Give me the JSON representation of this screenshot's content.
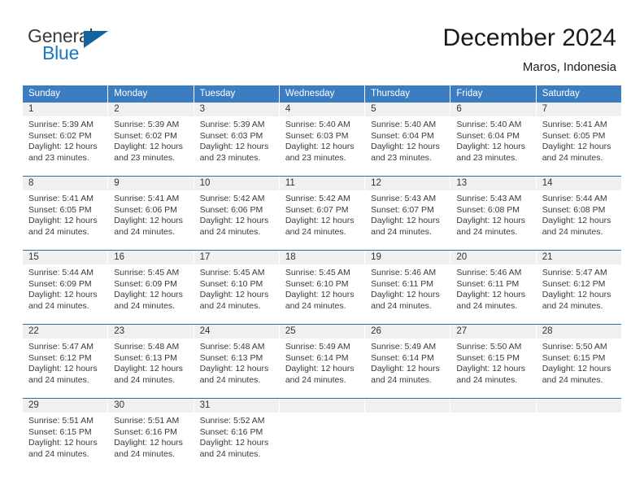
{
  "brand": {
    "name_part1": "General",
    "name_part2": "Blue",
    "logo_icon": "blue-triangle-icon"
  },
  "header": {
    "month_title": "December 2024",
    "location": "Maros, Indonesia"
  },
  "calendar": {
    "weekday_headers": [
      "Sunday",
      "Monday",
      "Tuesday",
      "Wednesday",
      "Thursday",
      "Friday",
      "Saturday"
    ],
    "colors": {
      "header_blue": "#3b7dc0",
      "row_divider_blue": "#2f6fad",
      "daynum_band": "#f0f0f0",
      "brand_blue": "#1779c4",
      "brand_gray": "#3b3b3b"
    },
    "weeks": [
      [
        {
          "day": "1",
          "sunrise": "Sunrise: 5:39 AM",
          "sunset": "Sunset: 6:02 PM",
          "daylight_line1": "Daylight: 12 hours",
          "daylight_line2": "and 23 minutes."
        },
        {
          "day": "2",
          "sunrise": "Sunrise: 5:39 AM",
          "sunset": "Sunset: 6:02 PM",
          "daylight_line1": "Daylight: 12 hours",
          "daylight_line2": "and 23 minutes."
        },
        {
          "day": "3",
          "sunrise": "Sunrise: 5:39 AM",
          "sunset": "Sunset: 6:03 PM",
          "daylight_line1": "Daylight: 12 hours",
          "daylight_line2": "and 23 minutes."
        },
        {
          "day": "4",
          "sunrise": "Sunrise: 5:40 AM",
          "sunset": "Sunset: 6:03 PM",
          "daylight_line1": "Daylight: 12 hours",
          "daylight_line2": "and 23 minutes."
        },
        {
          "day": "5",
          "sunrise": "Sunrise: 5:40 AM",
          "sunset": "Sunset: 6:04 PM",
          "daylight_line1": "Daylight: 12 hours",
          "daylight_line2": "and 23 minutes."
        },
        {
          "day": "6",
          "sunrise": "Sunrise: 5:40 AM",
          "sunset": "Sunset: 6:04 PM",
          "daylight_line1": "Daylight: 12 hours",
          "daylight_line2": "and 23 minutes."
        },
        {
          "day": "7",
          "sunrise": "Sunrise: 5:41 AM",
          "sunset": "Sunset: 6:05 PM",
          "daylight_line1": "Daylight: 12 hours",
          "daylight_line2": "and 24 minutes."
        }
      ],
      [
        {
          "day": "8",
          "sunrise": "Sunrise: 5:41 AM",
          "sunset": "Sunset: 6:05 PM",
          "daylight_line1": "Daylight: 12 hours",
          "daylight_line2": "and 24 minutes."
        },
        {
          "day": "9",
          "sunrise": "Sunrise: 5:41 AM",
          "sunset": "Sunset: 6:06 PM",
          "daylight_line1": "Daylight: 12 hours",
          "daylight_line2": "and 24 minutes."
        },
        {
          "day": "10",
          "sunrise": "Sunrise: 5:42 AM",
          "sunset": "Sunset: 6:06 PM",
          "daylight_line1": "Daylight: 12 hours",
          "daylight_line2": "and 24 minutes."
        },
        {
          "day": "11",
          "sunrise": "Sunrise: 5:42 AM",
          "sunset": "Sunset: 6:07 PM",
          "daylight_line1": "Daylight: 12 hours",
          "daylight_line2": "and 24 minutes."
        },
        {
          "day": "12",
          "sunrise": "Sunrise: 5:43 AM",
          "sunset": "Sunset: 6:07 PM",
          "daylight_line1": "Daylight: 12 hours",
          "daylight_line2": "and 24 minutes."
        },
        {
          "day": "13",
          "sunrise": "Sunrise: 5:43 AM",
          "sunset": "Sunset: 6:08 PM",
          "daylight_line1": "Daylight: 12 hours",
          "daylight_line2": "and 24 minutes."
        },
        {
          "day": "14",
          "sunrise": "Sunrise: 5:44 AM",
          "sunset": "Sunset: 6:08 PM",
          "daylight_line1": "Daylight: 12 hours",
          "daylight_line2": "and 24 minutes."
        }
      ],
      [
        {
          "day": "15",
          "sunrise": "Sunrise: 5:44 AM",
          "sunset": "Sunset: 6:09 PM",
          "daylight_line1": "Daylight: 12 hours",
          "daylight_line2": "and 24 minutes."
        },
        {
          "day": "16",
          "sunrise": "Sunrise: 5:45 AM",
          "sunset": "Sunset: 6:09 PM",
          "daylight_line1": "Daylight: 12 hours",
          "daylight_line2": "and 24 minutes."
        },
        {
          "day": "17",
          "sunrise": "Sunrise: 5:45 AM",
          "sunset": "Sunset: 6:10 PM",
          "daylight_line1": "Daylight: 12 hours",
          "daylight_line2": "and 24 minutes."
        },
        {
          "day": "18",
          "sunrise": "Sunrise: 5:45 AM",
          "sunset": "Sunset: 6:10 PM",
          "daylight_line1": "Daylight: 12 hours",
          "daylight_line2": "and 24 minutes."
        },
        {
          "day": "19",
          "sunrise": "Sunrise: 5:46 AM",
          "sunset": "Sunset: 6:11 PM",
          "daylight_line1": "Daylight: 12 hours",
          "daylight_line2": "and 24 minutes."
        },
        {
          "day": "20",
          "sunrise": "Sunrise: 5:46 AM",
          "sunset": "Sunset: 6:11 PM",
          "daylight_line1": "Daylight: 12 hours",
          "daylight_line2": "and 24 minutes."
        },
        {
          "day": "21",
          "sunrise": "Sunrise: 5:47 AM",
          "sunset": "Sunset: 6:12 PM",
          "daylight_line1": "Daylight: 12 hours",
          "daylight_line2": "and 24 minutes."
        }
      ],
      [
        {
          "day": "22",
          "sunrise": "Sunrise: 5:47 AM",
          "sunset": "Sunset: 6:12 PM",
          "daylight_line1": "Daylight: 12 hours",
          "daylight_line2": "and 24 minutes."
        },
        {
          "day": "23",
          "sunrise": "Sunrise: 5:48 AM",
          "sunset": "Sunset: 6:13 PM",
          "daylight_line1": "Daylight: 12 hours",
          "daylight_line2": "and 24 minutes."
        },
        {
          "day": "24",
          "sunrise": "Sunrise: 5:48 AM",
          "sunset": "Sunset: 6:13 PM",
          "daylight_line1": "Daylight: 12 hours",
          "daylight_line2": "and 24 minutes."
        },
        {
          "day": "25",
          "sunrise": "Sunrise: 5:49 AM",
          "sunset": "Sunset: 6:14 PM",
          "daylight_line1": "Daylight: 12 hours",
          "daylight_line2": "and 24 minutes."
        },
        {
          "day": "26",
          "sunrise": "Sunrise: 5:49 AM",
          "sunset": "Sunset: 6:14 PM",
          "daylight_line1": "Daylight: 12 hours",
          "daylight_line2": "and 24 minutes."
        },
        {
          "day": "27",
          "sunrise": "Sunrise: 5:50 AM",
          "sunset": "Sunset: 6:15 PM",
          "daylight_line1": "Daylight: 12 hours",
          "daylight_line2": "and 24 minutes."
        },
        {
          "day": "28",
          "sunrise": "Sunrise: 5:50 AM",
          "sunset": "Sunset: 6:15 PM",
          "daylight_line1": "Daylight: 12 hours",
          "daylight_line2": "and 24 minutes."
        }
      ],
      [
        {
          "day": "29",
          "sunrise": "Sunrise: 5:51 AM",
          "sunset": "Sunset: 6:15 PM",
          "daylight_line1": "Daylight: 12 hours",
          "daylight_line2": "and 24 minutes."
        },
        {
          "day": "30",
          "sunrise": "Sunrise: 5:51 AM",
          "sunset": "Sunset: 6:16 PM",
          "daylight_line1": "Daylight: 12 hours",
          "daylight_line2": "and 24 minutes."
        },
        {
          "day": "31",
          "sunrise": "Sunrise: 5:52 AM",
          "sunset": "Sunset: 6:16 PM",
          "daylight_line1": "Daylight: 12 hours",
          "daylight_line2": "and 24 minutes."
        },
        {
          "day": "",
          "sunrise": "",
          "sunset": "",
          "daylight_line1": "",
          "daylight_line2": ""
        },
        {
          "day": "",
          "sunrise": "",
          "sunset": "",
          "daylight_line1": "",
          "daylight_line2": ""
        },
        {
          "day": "",
          "sunrise": "",
          "sunset": "",
          "daylight_line1": "",
          "daylight_line2": ""
        },
        {
          "day": "",
          "sunrise": "",
          "sunset": "",
          "daylight_line1": "",
          "daylight_line2": ""
        }
      ]
    ]
  }
}
